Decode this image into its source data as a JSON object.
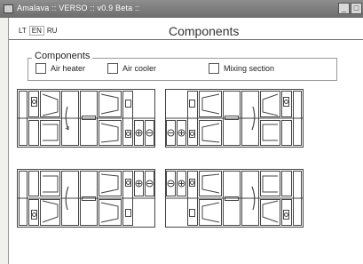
{
  "window": {
    "title": "Amalava :: VERSO :: v0.9 Beta ::",
    "icons": [
      "app-icon",
      "minimize-icon",
      "maximize-icon"
    ]
  },
  "languages": [
    {
      "code": "LT",
      "active": false
    },
    {
      "code": "EN",
      "active": true
    },
    {
      "code": "RU",
      "active": false
    }
  ],
  "page": {
    "title": "Components"
  },
  "components_group": {
    "label": "Components",
    "options": [
      {
        "label": "Air heater",
        "checked": false
      },
      {
        "label": "Air cooler",
        "checked": false
      },
      {
        "label": "Mixing section",
        "checked": false
      }
    ]
  },
  "units": [
    {
      "name": "unit-top-left",
      "orientation": "right"
    },
    {
      "name": "unit-top-right",
      "orientation": "left"
    },
    {
      "name": "unit-bottom-left",
      "orientation": "right"
    },
    {
      "name": "unit-bottom-right",
      "orientation": "left"
    }
  ],
  "colors": {
    "titlebar": "#7d7d7d",
    "background": "#ffffff",
    "stroke": "#444444"
  }
}
